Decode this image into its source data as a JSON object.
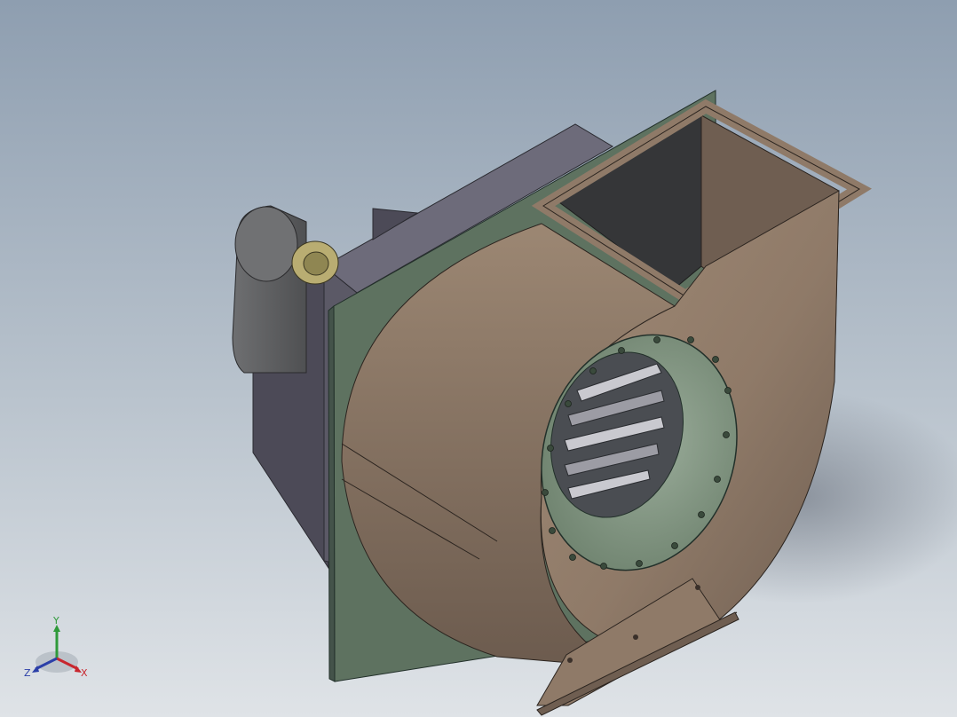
{
  "triad": {
    "x_label": "X",
    "y_label": "Y",
    "z_label": "Z",
    "x_color": "#c8262e",
    "y_color": "#2f9a3a",
    "z_color": "#2b3fa8"
  },
  "colors": {
    "housing": "#8f7a68",
    "housing_dark": "#6a5a4d",
    "backplate": "#5e7260",
    "inlet_ring": "#7d907e",
    "motor_frame": "#5b5966",
    "motor": "#5d5e60",
    "coupling": "#b9ad72"
  }
}
